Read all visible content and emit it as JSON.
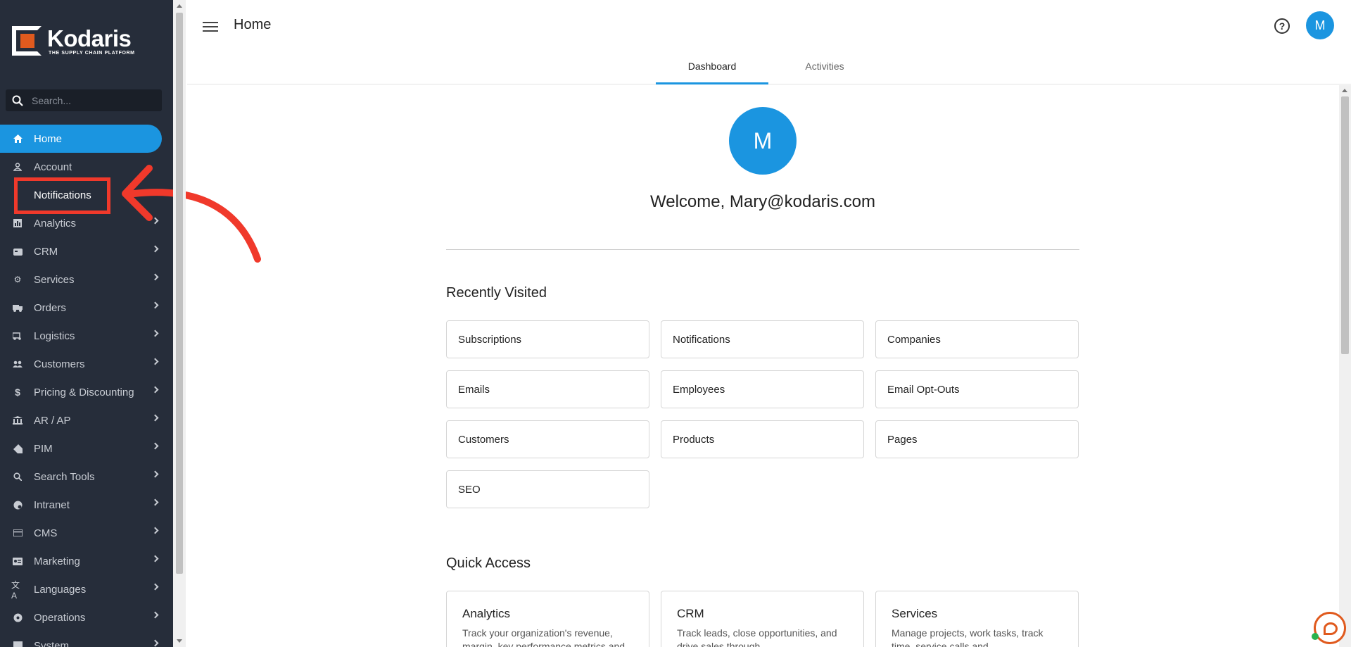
{
  "brand": {
    "name": "Kodaris",
    "tagline": "THE SUPPLY CHAIN PLATFORM",
    "accent": "#1b95e0",
    "logo_color": "#e05a1e"
  },
  "sidebar": {
    "search_placeholder": "Search...",
    "items": [
      {
        "label": "Home",
        "icon": "home-icon",
        "active": true
      },
      {
        "label": "Account",
        "icon": "user-icon"
      },
      {
        "label": "Notifications",
        "icon": "",
        "sub": true
      },
      {
        "label": "Analytics",
        "icon": "analytics-icon"
      },
      {
        "label": "CRM",
        "icon": "crm-icon"
      },
      {
        "label": "Services",
        "icon": "services-icon"
      },
      {
        "label": "Orders",
        "icon": "truck-icon"
      },
      {
        "label": "Logistics",
        "icon": "logistics-icon"
      },
      {
        "label": "Customers",
        "icon": "people-icon"
      },
      {
        "label": "Pricing & Discounting",
        "icon": "dollar-icon"
      },
      {
        "label": "AR / AP",
        "icon": "bank-icon"
      },
      {
        "label": "PIM",
        "icon": "tag-icon"
      },
      {
        "label": "Search Tools",
        "icon": "search-icon"
      },
      {
        "label": "Intranet",
        "icon": "intranet-icon"
      },
      {
        "label": "CMS",
        "icon": "cms-icon"
      },
      {
        "label": "Marketing",
        "icon": "marketing-icon"
      },
      {
        "label": "Languages",
        "icon": "translate-icon"
      },
      {
        "label": "Operations",
        "icon": "operations-icon"
      },
      {
        "label": "System",
        "icon": "system-icon"
      }
    ]
  },
  "header": {
    "title": "Home",
    "avatar_initial": "M",
    "help_glyph": "?",
    "tabs": [
      {
        "label": "Dashboard",
        "active": true
      },
      {
        "label": "Activities",
        "active": false
      }
    ]
  },
  "main": {
    "avatar_initial": "M",
    "welcome": "Welcome, Mary@kodaris.com",
    "recently_visited": {
      "title": "Recently Visited",
      "items": [
        "Subscriptions",
        "Notifications",
        "Companies",
        "Emails",
        "Employees",
        "Email Opt-Outs",
        "Customers",
        "Products",
        "Pages",
        "SEO"
      ]
    },
    "quick_access": {
      "title": "Quick Access",
      "items": [
        {
          "title": "Analytics",
          "desc": "Track your organization's revenue, margin, key performance metrics and"
        },
        {
          "title": "CRM",
          "desc": "Track leads, close opportunities, and drive sales through"
        },
        {
          "title": "Services",
          "desc": "Manage projects, work tasks, track time, service calls and"
        }
      ]
    }
  }
}
